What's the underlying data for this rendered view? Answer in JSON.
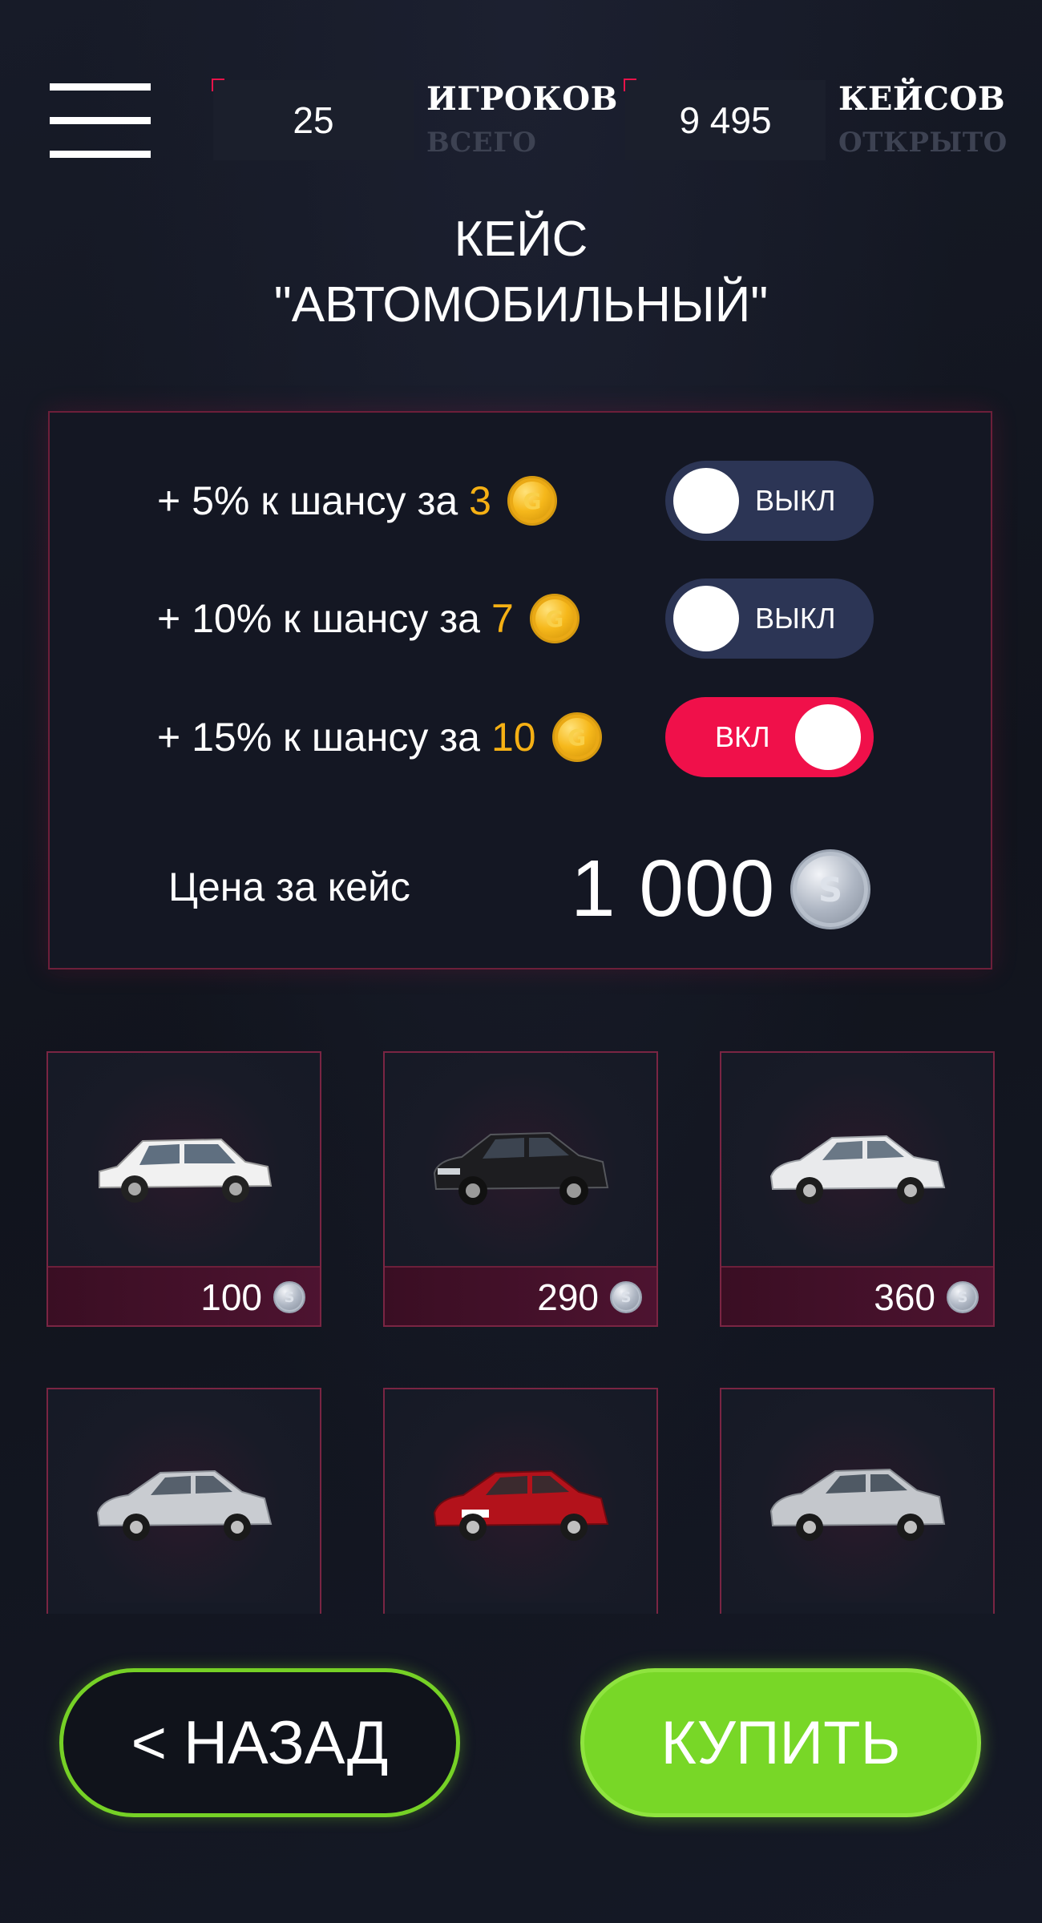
{
  "header": {
    "menu_icon": "hamburger-menu-icon",
    "players": {
      "value": "25",
      "title": "ИГРОКОВ",
      "subtitle": "ВСЕГО"
    },
    "cases": {
      "value": "9 495",
      "title": "КЕЙСОВ",
      "subtitle": "ОТКРЫТО"
    }
  },
  "case": {
    "title_line1": "КЕЙС",
    "title_line2": "\"АВТОМОБИЛЬНЫЙ\""
  },
  "options": [
    {
      "text": "+ 5% к шансу за",
      "cost": "3",
      "coin": "G",
      "toggle_label": "ВЫКЛ",
      "enabled": false
    },
    {
      "text": "+ 10% к шансу за",
      "cost": "7",
      "coin": "G",
      "toggle_label": "ВЫКЛ",
      "enabled": false
    },
    {
      "text": "+ 15% к шансу за",
      "cost": "10",
      "coin": "G",
      "toggle_label": "ВКЛ",
      "enabled": true
    }
  ],
  "price": {
    "label": "Цена за кейс",
    "value": "1 000",
    "coin": "S"
  },
  "items": [
    {
      "price": "100",
      "coin": "S",
      "car_color": "#f1f1f1",
      "car_icon": "white-sedan-icon"
    },
    {
      "price": "290",
      "coin": "S",
      "car_color": "#1d1d20",
      "car_icon": "black-sedan-icon"
    },
    {
      "price": "360",
      "coin": "S",
      "car_color": "#e9eaec",
      "car_icon": "white-sedan-icon"
    },
    {
      "car_color": "#c9ccd1",
      "car_icon": "silver-sedan-icon"
    },
    {
      "car_color": "#b3121b",
      "car_icon": "red-sedan-icon"
    },
    {
      "car_color": "#c4c7cc",
      "car_icon": "silver-sedan-icon"
    }
  ],
  "buttons": {
    "back_label": "< НАЗАД",
    "buy_label": "КУПИТЬ"
  },
  "colors": {
    "accent_red": "#f0104a",
    "accent_green": "#78d727",
    "gold": "#f5b014",
    "toggle_off": "#2c3555"
  }
}
